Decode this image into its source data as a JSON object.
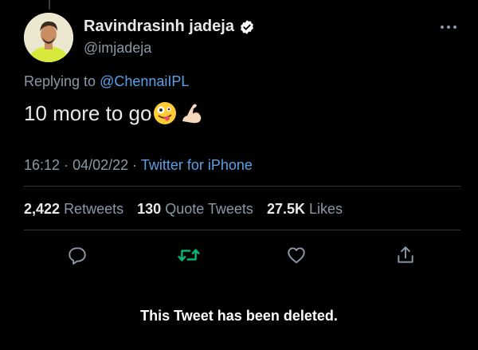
{
  "author": {
    "name": "Ravindrasinh jadeja",
    "handle": "@imjadeja"
  },
  "reply": {
    "prefix": "Replying to",
    "mention": "@ChennaiIPL"
  },
  "tweet": {
    "text": "10 more to go",
    "emojis": [
      "zany-face-icon",
      "flexed-biceps-icon"
    ]
  },
  "meta": {
    "time": "16:12",
    "separator": "·",
    "date": "04/02/22",
    "source": "Twitter for iPhone"
  },
  "stats": {
    "retweets": {
      "count": "2,422",
      "label": "Retweets"
    },
    "quotes": {
      "count": "130",
      "label": "Quote Tweets"
    },
    "likes": {
      "count": "27.5K",
      "label": "Likes"
    }
  },
  "actions": [
    "reply-icon",
    "retweet-icon",
    "like-icon",
    "share-icon"
  ],
  "notice": "This Tweet has been deleted.",
  "colors": {
    "background": "#000000",
    "link": "#5ba0e6",
    "retweet_active": "#00ba7c",
    "secondary_text": "#8b98a5"
  }
}
